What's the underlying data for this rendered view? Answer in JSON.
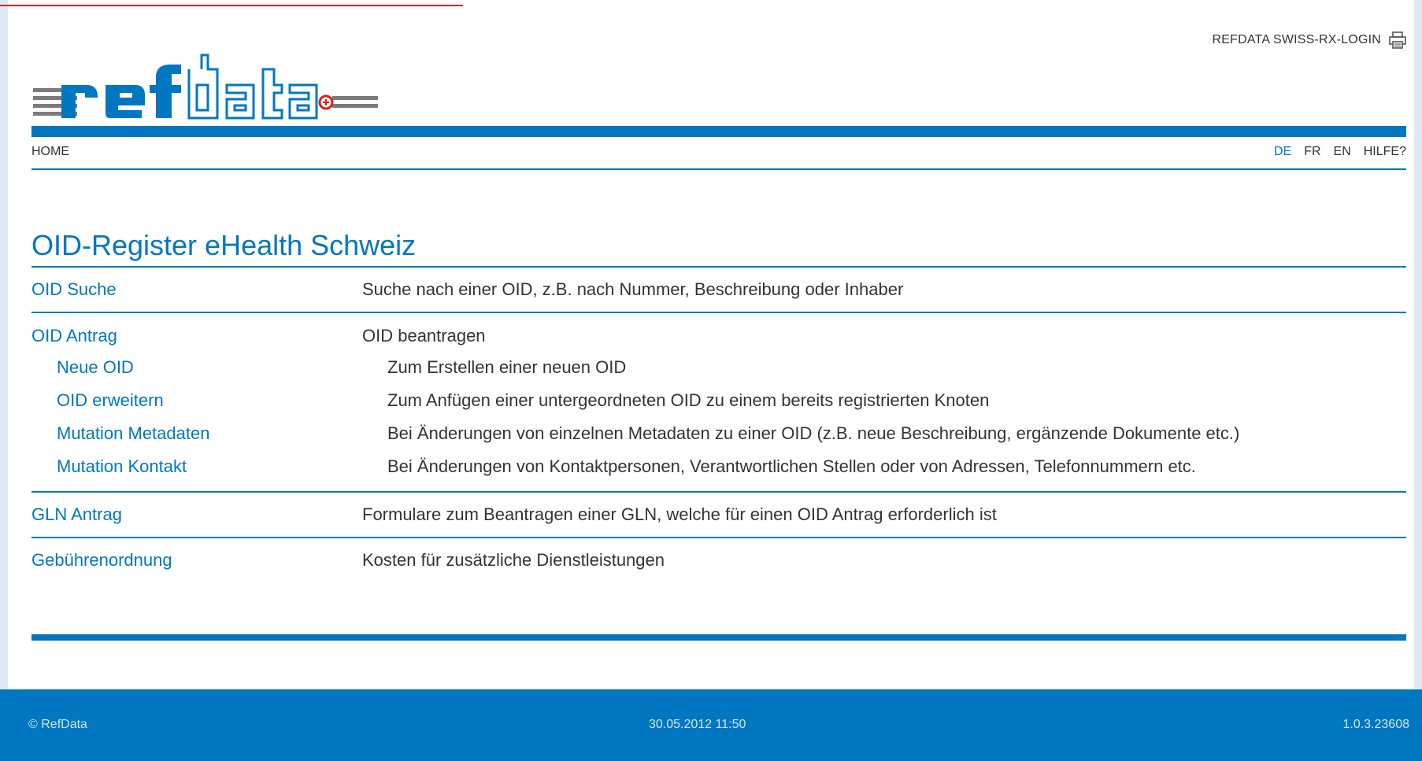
{
  "header": {
    "login_label": "REFDATA SWISS-RX-LOGIN",
    "print_icon": "printer-icon",
    "logo_text": "refdata"
  },
  "nav": {
    "home": "HOME",
    "languages": [
      "DE",
      "FR",
      "EN"
    ],
    "active_language": "DE",
    "help": "HILFE?"
  },
  "main": {
    "title": "OID-Register eHealth Schweiz",
    "sections": [
      {
        "label": "OID Suche",
        "desc": "Suche nach einer OID, z.B. nach Nummer, Beschreibung oder Inhaber"
      },
      {
        "label": "OID Antrag",
        "desc": "OID beantragen",
        "items": [
          {
            "label": "Neue OID",
            "desc": "Zum Erstellen einer neuen OID"
          },
          {
            "label": "OID erweitern",
            "desc": "Zum Anfügen einer untergeordneten OID zu einem bereits registrierten Knoten"
          },
          {
            "label": "Mutation Metadaten",
            "desc": "Bei Änderungen von einzelnen Metadaten zu einer OID (z.B. neue Beschreibung, ergänzende Dokumente etc.)"
          },
          {
            "label": "Mutation Kontakt",
            "desc": "Bei Änderungen von Kontaktpersonen, Verantwortlichen Stellen oder von Adressen, Telefonnummern etc."
          }
        ]
      },
      {
        "label": "GLN Antrag",
        "desc": "Formulare zum Beantragen einer GLN, welche für einen OID Antrag erforderlich ist"
      },
      {
        "label": "Gebührenordnung",
        "desc": "Kosten für zusätzliche Dienstleistungen"
      }
    ]
  },
  "footer": {
    "copyright": "© RefData",
    "datetime": "30.05.2012 11:50",
    "version": "1.0.3.23608"
  },
  "colors": {
    "accent": "#0077c0",
    "side_strip": "#dde9f3",
    "red_line": "#e31b1b"
  }
}
